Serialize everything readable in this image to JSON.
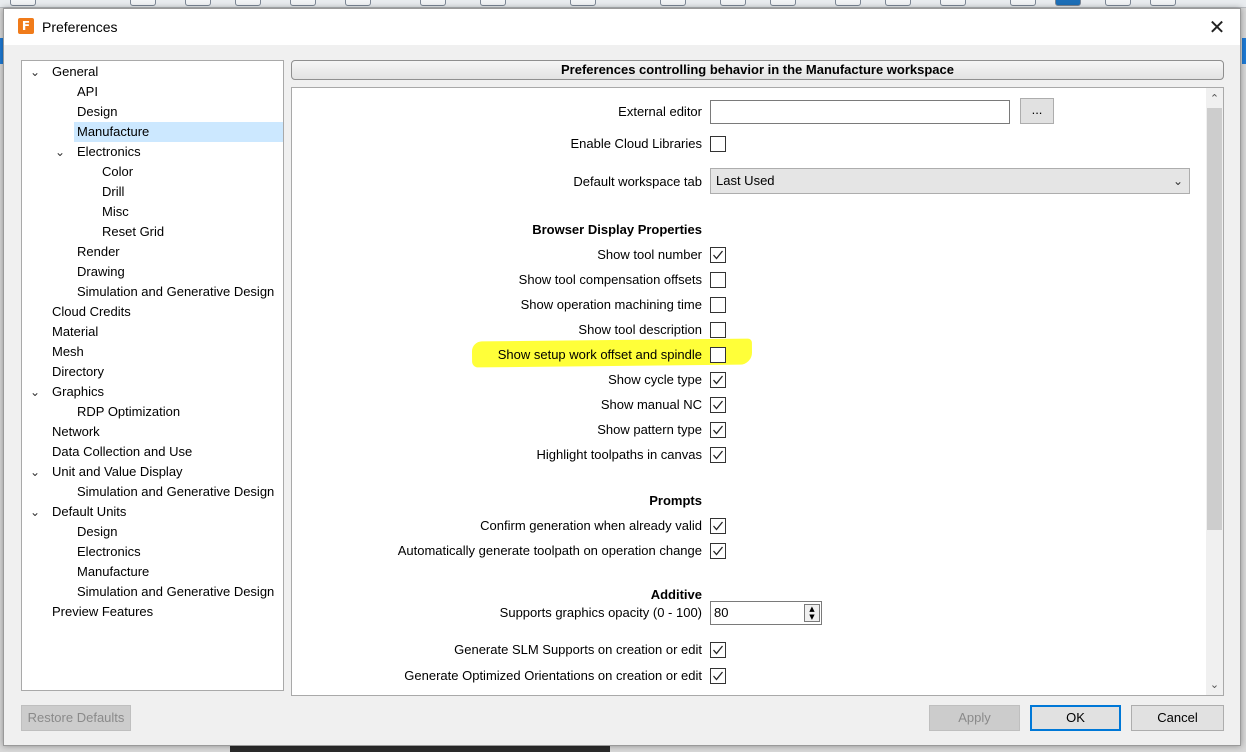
{
  "dialog": {
    "title": "Preferences",
    "app_icon_letter": "F",
    "close_glyph": "✕"
  },
  "tree": {
    "items": [
      {
        "label": "General",
        "level": 0,
        "expanded": true
      },
      {
        "label": "API",
        "level": 1
      },
      {
        "label": "Design",
        "level": 1
      },
      {
        "label": "Manufacture",
        "level": 1,
        "selected": true
      },
      {
        "label": "Electronics",
        "level": 1,
        "expanded": true
      },
      {
        "label": "Color",
        "level": 2
      },
      {
        "label": "Drill",
        "level": 2
      },
      {
        "label": "Misc",
        "level": 2
      },
      {
        "label": "Reset Grid",
        "level": 2
      },
      {
        "label": "Render",
        "level": 1
      },
      {
        "label": "Drawing",
        "level": 1
      },
      {
        "label": "Simulation and Generative Design",
        "level": 1
      },
      {
        "label": "Cloud Credits",
        "level": 0
      },
      {
        "label": "Material",
        "level": 0
      },
      {
        "label": "Mesh",
        "level": 0
      },
      {
        "label": "Directory",
        "level": 0
      },
      {
        "label": "Graphics",
        "level": 0,
        "expanded": true
      },
      {
        "label": "RDP Optimization",
        "level": 1
      },
      {
        "label": "Network",
        "level": 0
      },
      {
        "label": "Data Collection and Use",
        "level": 0
      },
      {
        "label": "Unit and Value Display",
        "level": 0,
        "expanded": true
      },
      {
        "label": "Simulation and Generative Design",
        "level": 1
      },
      {
        "label": "Default Units",
        "level": 0,
        "expanded": true
      },
      {
        "label": "Design",
        "level": 1
      },
      {
        "label": "Electronics",
        "level": 1
      },
      {
        "label": "Manufacture",
        "level": 1
      },
      {
        "label": "Simulation and Generative Design",
        "level": 1
      },
      {
        "label": "Preview Features",
        "level": 0
      }
    ]
  },
  "panel": {
    "header": "Preferences controlling behavior in the Manufacture workspace",
    "external_editor_label": "External editor",
    "external_editor_value": "",
    "ellipsis_label": "...",
    "enable_cloud_label": "Enable Cloud Libraries",
    "enable_cloud_checked": false,
    "default_tab_label": "Default workspace tab",
    "default_tab_value": "Last Used",
    "browser_section": "Browser Display Properties",
    "browser_items": [
      {
        "label": "Show tool number",
        "checked": true
      },
      {
        "label": "Show tool compensation offsets",
        "checked": false
      },
      {
        "label": "Show operation machining time",
        "checked": false
      },
      {
        "label": "Show tool description",
        "checked": false
      },
      {
        "label": "Show setup work offset and spindle",
        "checked": false,
        "highlighted": true
      },
      {
        "label": "Show cycle type",
        "checked": true
      },
      {
        "label": "Show manual NC",
        "checked": true
      },
      {
        "label": "Show pattern type",
        "checked": true
      },
      {
        "label": "Highlight toolpaths in canvas",
        "checked": true
      }
    ],
    "prompts_section": "Prompts",
    "prompts_items": [
      {
        "label": "Confirm generation when already valid",
        "checked": true
      },
      {
        "label": "Automatically generate toolpath on operation change",
        "checked": true
      }
    ],
    "additive_section": "Additive",
    "opacity_label": "Supports graphics opacity (0 - 100)",
    "opacity_value": "80",
    "additive_items": [
      {
        "label": "Generate SLM Supports on creation or edit",
        "checked": true
      },
      {
        "label": "Generate Optimized Orientations on creation or edit",
        "checked": true
      }
    ],
    "highlight_color": "#ffff2e"
  },
  "buttons": {
    "restore_defaults": "Restore Defaults",
    "apply": "Apply",
    "ok": "OK",
    "cancel": "Cancel"
  }
}
